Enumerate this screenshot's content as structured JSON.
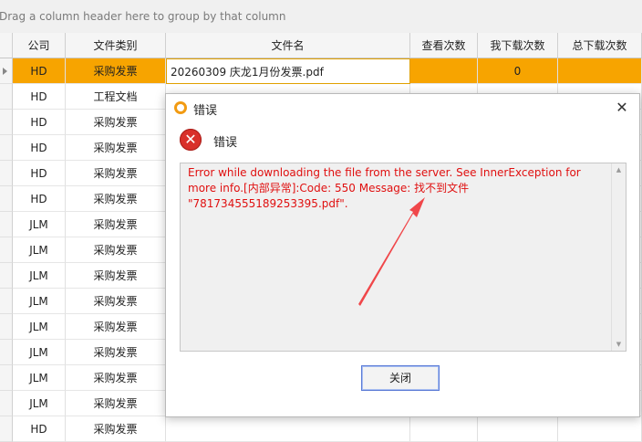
{
  "group_panel": {
    "hint": "Drag a column header here to group by that column"
  },
  "columns": [
    "公司",
    "文件类别",
    "文件名",
    "查看次数",
    "我下载次数",
    "总下载次数"
  ],
  "rows": [
    {
      "company": "HD",
      "category": "采购发票",
      "filename": "20260309 庆龙1月份发票.pdf",
      "views": "",
      "my_downloads": "0",
      "total_downloads": "",
      "selected": true
    },
    {
      "company": "HD",
      "category": "工程文档",
      "filename": "",
      "views": "",
      "my_downloads": "",
      "total_downloads": ""
    },
    {
      "company": "HD",
      "category": "采购发票",
      "filename": "",
      "views": "",
      "my_downloads": "",
      "total_downloads": ""
    },
    {
      "company": "HD",
      "category": "采购发票",
      "filename": "",
      "views": "",
      "my_downloads": "",
      "total_downloads": ""
    },
    {
      "company": "HD",
      "category": "采购发票",
      "filename": "",
      "views": "",
      "my_downloads": "",
      "total_downloads": ""
    },
    {
      "company": "HD",
      "category": "采购发票",
      "filename": "",
      "views": "",
      "my_downloads": "",
      "total_downloads": ""
    },
    {
      "company": "JLM",
      "category": "采购发票",
      "filename": "",
      "views": "",
      "my_downloads": "",
      "total_downloads": ""
    },
    {
      "company": "JLM",
      "category": "采购发票",
      "filename": "",
      "views": "",
      "my_downloads": "",
      "total_downloads": ""
    },
    {
      "company": "JLM",
      "category": "采购发票",
      "filename": "",
      "views": "",
      "my_downloads": "",
      "total_downloads": ""
    },
    {
      "company": "JLM",
      "category": "采购发票",
      "filename": "",
      "views": "",
      "my_downloads": "",
      "total_downloads": ""
    },
    {
      "company": "JLM",
      "category": "采购发票",
      "filename": "",
      "views": "",
      "my_downloads": "",
      "total_downloads": ""
    },
    {
      "company": "JLM",
      "category": "采购发票",
      "filename": "",
      "views": "",
      "my_downloads": "",
      "total_downloads": ""
    },
    {
      "company": "JLM",
      "category": "采购发票",
      "filename": "",
      "views": "",
      "my_downloads": "",
      "total_downloads": ""
    },
    {
      "company": "JLM",
      "category": "采购发票",
      "filename": "",
      "views": "",
      "my_downloads": "",
      "total_downloads": ""
    },
    {
      "company": "HD",
      "category": "采购发票",
      "filename": "",
      "views": "",
      "my_downloads": "",
      "total_downloads": ""
    }
  ],
  "dialog": {
    "title": "错误",
    "error_label": "错误",
    "message": "Error while downloading the file from the server. See InnerException for more info.[内部异常]:Code: 550 Message: 找不到文件 \"781734555189253395.pdf\".",
    "close_button": "关闭"
  },
  "colors": {
    "selected_row": "#f7a400",
    "error_text": "#e01010",
    "annotation_arrow": "#f0474a"
  }
}
